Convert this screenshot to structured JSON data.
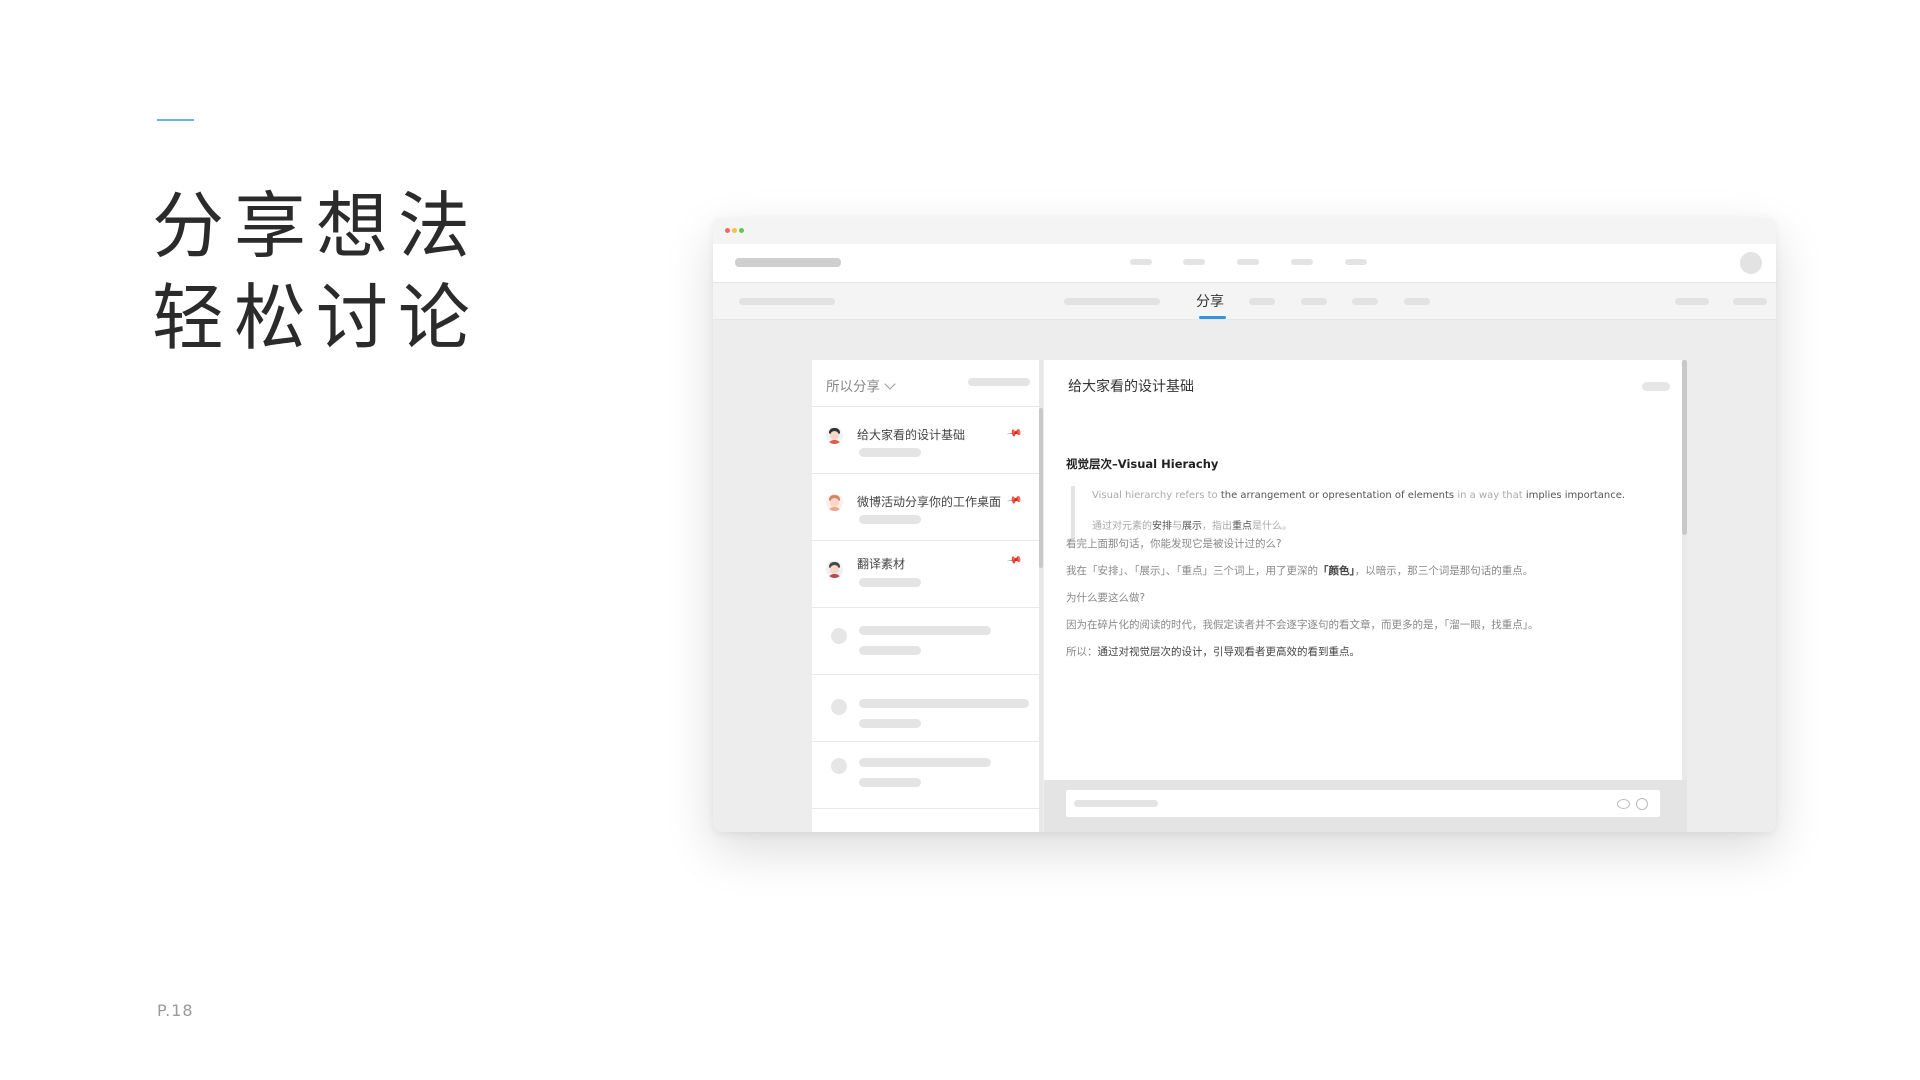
{
  "slide": {
    "headline_line1": "分享想法",
    "headline_line2": "轻松讨论",
    "page_number": "P.18",
    "accent_color": "#6fb3e0"
  },
  "window": {
    "traffic_lights": [
      "#ef6a5e",
      "#f4bf4f",
      "#62c655"
    ],
    "subnav_active_tab": "分享",
    "accent_color": "#2f95db"
  },
  "list": {
    "filter_label": "所以分享",
    "items": [
      {
        "title": "给大家看的设计基础",
        "avatar": "avatar-icon",
        "pinned": true
      },
      {
        "title": "微博活动分享你的工作桌面",
        "avatar": "avatar-icon",
        "pinned": true
      },
      {
        "title": "翻译素材",
        "avatar": "avatar-icon",
        "pinned": true
      }
    ]
  },
  "content": {
    "title": "给大家看的设计基础",
    "section_title": "视觉层次–Visual Hierachy",
    "quote_en": {
      "p1": "Visual hierarchy refers to ",
      "b1": "the arrangement or opresentation of elements",
      "p2": " in a way that ",
      "b2": "implies importance."
    },
    "quote_cn": {
      "p1": "通过对元素的",
      "b1": "安排",
      "p2": "与",
      "b2": "展示",
      "p3": "，指出",
      "b3": "重点",
      "p4": "是什么。"
    },
    "line1": "看完上面那句话，你能发现它是被设计过的么?",
    "line2_a": "我在「安排」、「展示」、「重点」三个词上，用了更深的",
    "line2_b": "「颜色」",
    "line2_c": "，以暗示，那三个词是那句话的重点。",
    "line3": "为什么要这么做?",
    "line4": "因为在碎片化的阅读的时代，我假定读者并不会逐字逐句的看文章，而更多的是，「溜一眼，找重点」。",
    "line5_a": "所以：",
    "line5_b": "通过对视觉层次的设计，引导观看者更高效的看到重点。"
  }
}
